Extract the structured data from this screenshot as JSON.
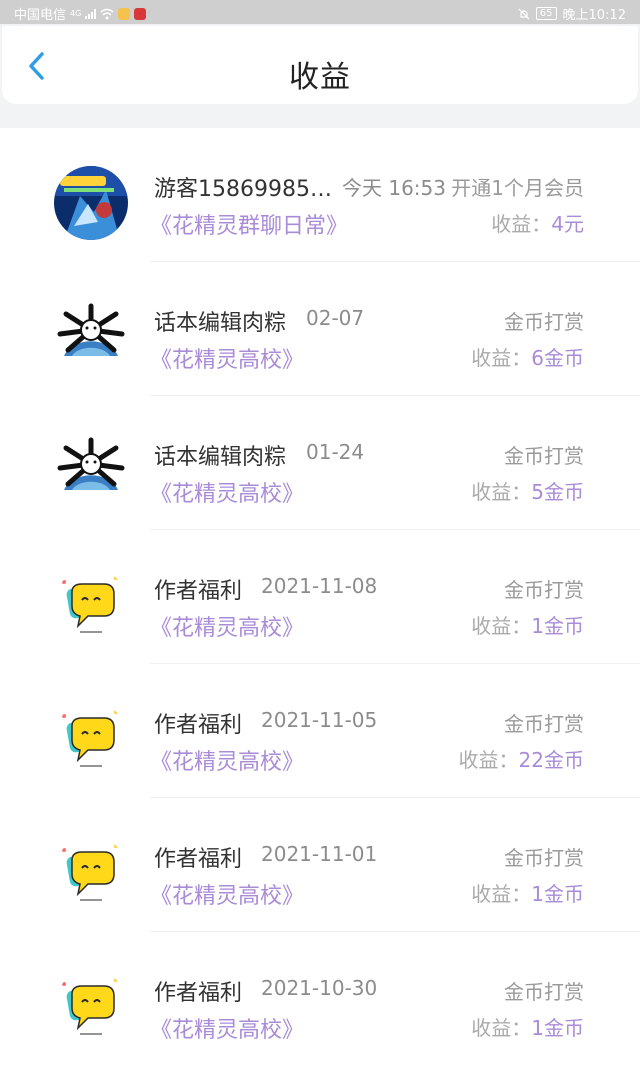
{
  "status_bar": {
    "carrier": "中国电信",
    "net": "4G",
    "time": "晚上10:12",
    "battery": "65"
  },
  "header": {
    "title": "收益"
  },
  "earn_label": "收益：",
  "rows": [
    {
      "name": "游客15869985…",
      "date": "今天 16:53",
      "type": "开通1个月会员",
      "book": "《花精灵群聊日常》",
      "amount": "4元",
      "avatar": "game-poster-avatar"
    },
    {
      "name": "话本编辑肉粽",
      "date": "02-07",
      "type": "金币打赏",
      "book": "《花精灵高校》",
      "amount": "6金币",
      "avatar": "cartoon-globe-avatar"
    },
    {
      "name": "话本编辑肉粽",
      "date": "01-24",
      "type": "金币打赏",
      "book": "《花精灵高校》",
      "amount": "5金币",
      "avatar": "cartoon-globe-avatar"
    },
    {
      "name": "作者福利",
      "date": "2021-11-08",
      "type": "金币打赏",
      "book": "《花精灵高校》",
      "amount": "1金币",
      "avatar": "chat-bubble-avatar"
    },
    {
      "name": "作者福利",
      "date": "2021-11-05",
      "type": "金币打赏",
      "book": "《花精灵高校》",
      "amount": "22金币",
      "avatar": "chat-bubble-avatar"
    },
    {
      "name": "作者福利",
      "date": "2021-11-01",
      "type": "金币打赏",
      "book": "《花精灵高校》",
      "amount": "1金币",
      "avatar": "chat-bubble-avatar"
    },
    {
      "name": "作者福利",
      "date": "2021-10-30",
      "type": "金币打赏",
      "book": "《花精灵高校》",
      "amount": "1金币",
      "avatar": "chat-bubble-avatar"
    }
  ],
  "colors": {
    "accent": "#2f9ee8",
    "book": "#a98bd8"
  }
}
